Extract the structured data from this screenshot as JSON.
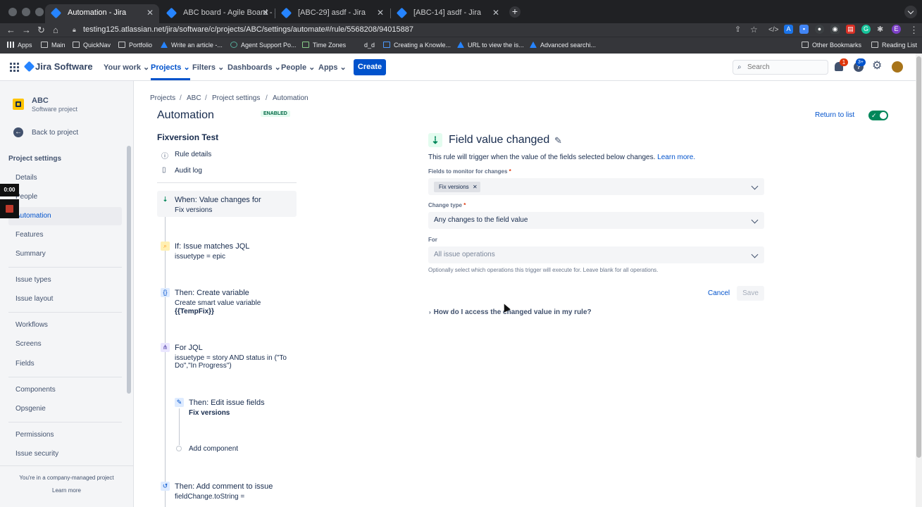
{
  "browser": {
    "tabs": [
      {
        "title": "Automation - Jira"
      },
      {
        "title": "ABC board - Agile Board - Jira"
      },
      {
        "title": "[ABC-29] asdf - Jira"
      },
      {
        "title": "[ABC-14] asdf - Jira"
      }
    ],
    "url": "testing125.atlassian.net/jira/software/c/projects/ABC/settings/automate#/rule/5568208/94015887",
    "bookmarks": [
      "Apps",
      "Main",
      "QuickNav",
      "Portfolio",
      "Write an article -...",
      "Agent Support Po...",
      "Time Zones",
      "d_d",
      "Creating a Knowle...",
      "URL to view the is...",
      "Advanced searchi..."
    ],
    "other_bookmarks": "Other Bookmarks",
    "reading_list": "Reading List"
  },
  "jira_nav": {
    "logo": "Jira Software",
    "items": [
      "Your work",
      "Projects",
      "Filters",
      "Dashboards",
      "People",
      "Apps"
    ],
    "create": "Create",
    "search_placeholder": "Search",
    "notif_count": "1",
    "help_count": "3+"
  },
  "sidebar": {
    "project_name": "ABC",
    "project_type": "Software project",
    "back": "Back to project",
    "section_title": "Project settings",
    "items": [
      "Details",
      "People",
      "Automation",
      "Features",
      "Summary",
      "Issue types",
      "Issue layout",
      "Workflows",
      "Screens",
      "Fields",
      "Components",
      "Opsgenie",
      "Permissions",
      "Issue security"
    ],
    "footer": "You're in a company-managed project",
    "learn_more": "Learn more",
    "timer": "0:00"
  },
  "breadcrumb": [
    "Projects",
    "ABC",
    "Project settings",
    "Automation"
  ],
  "page": {
    "title": "Automation",
    "status": "ENABLED",
    "return": "Return to list"
  },
  "rule": {
    "name": "Fixversion Test",
    "rule_details": "Rule details",
    "audit_log": "Audit log",
    "chain": [
      {
        "title": "When: Value changes for",
        "sub": "Fix versions"
      },
      {
        "title": "If: Issue matches JQL",
        "sub": "issuetype = epic"
      },
      {
        "title": "Then: Create variable",
        "sub": "Create smart value variable",
        "sub2": "{{TempFix}}"
      },
      {
        "title": "For JQL",
        "sub": "issuetype = story AND status in (\"To Do\",\"In Progress\")"
      },
      {
        "title": "Then: Edit issue fields",
        "sub": "Fix versions"
      },
      {
        "title": "Add component"
      },
      {
        "title": "Then: Add comment to issue",
        "sub": "fieldChange.toString ="
      }
    ]
  },
  "panel": {
    "title": "Field value changed",
    "description": "This rule will trigger when the value of the fields selected below changes.",
    "learn_more": "Learn more.",
    "fields_label": "Fields to monitor for changes",
    "fields_tag": "Fix versions",
    "change_type_label": "Change type",
    "change_type_value": "Any changes to the field value",
    "for_label": "For",
    "for_placeholder": "All issue operations",
    "for_help": "Optionally select which operations this trigger will execute for. Leave blank for all operations.",
    "cancel": "Cancel",
    "save": "Save",
    "help_toggle": "How do I access the changed value in my rule?"
  }
}
